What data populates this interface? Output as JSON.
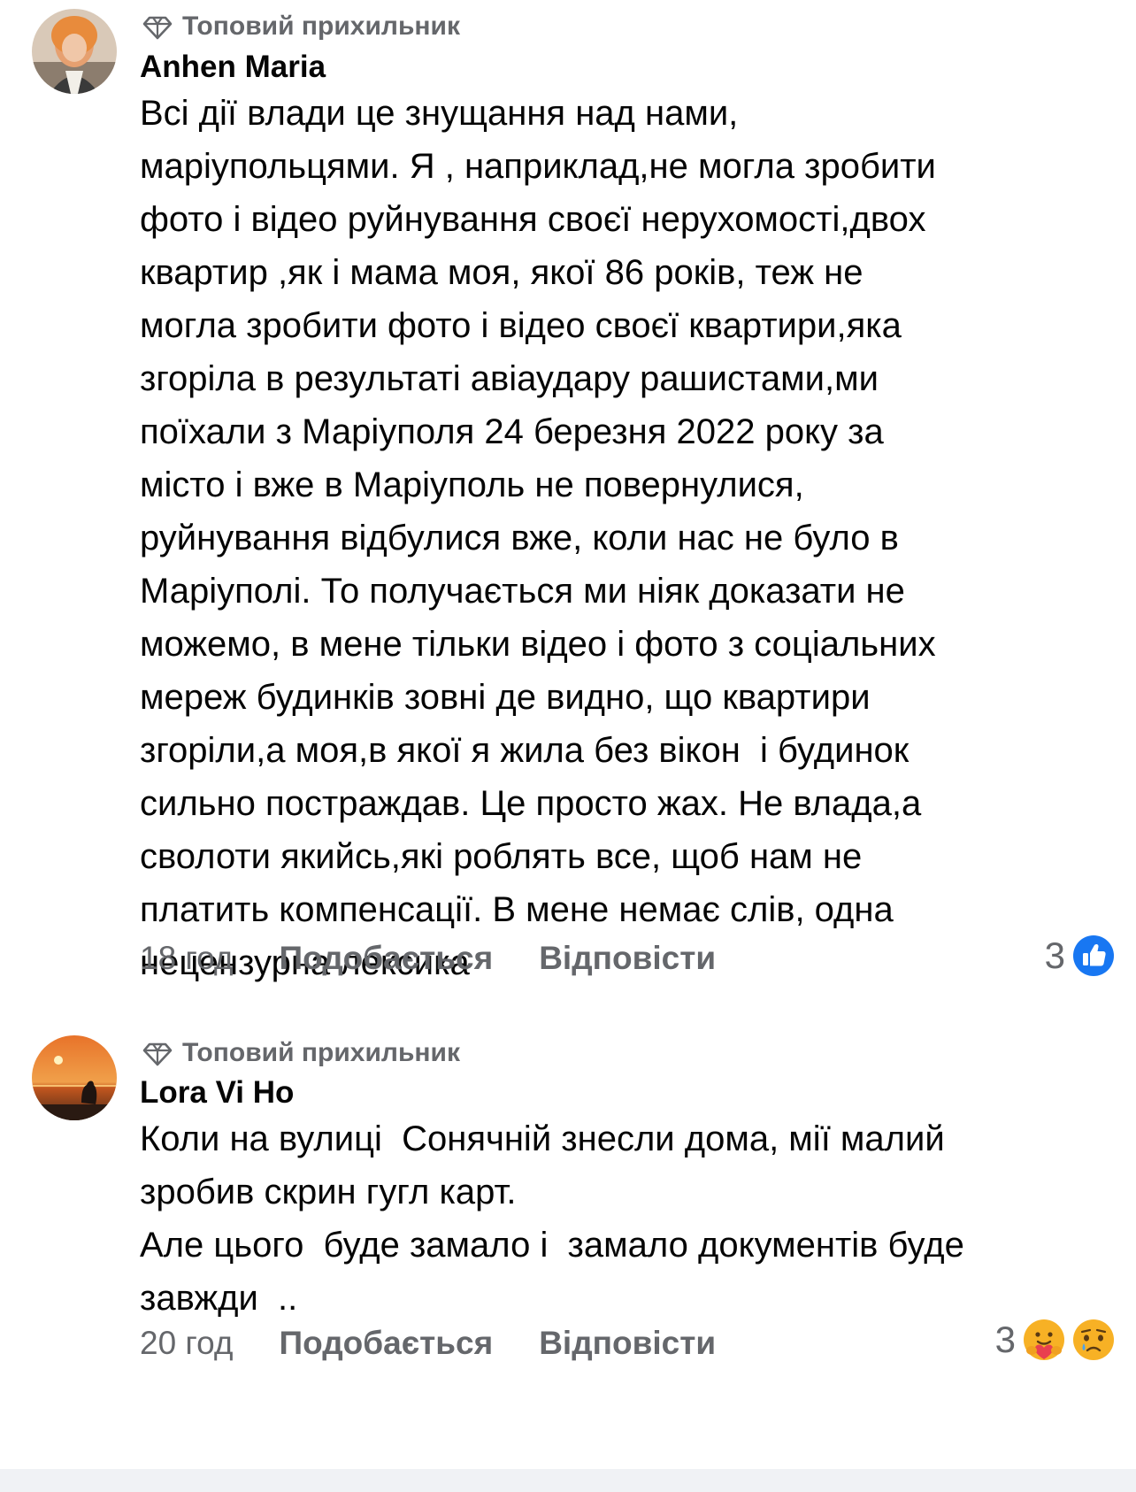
{
  "comments": [
    {
      "badge": "Топовий прихильник",
      "author": "Anhen Maria",
      "text": "Всі дії влади це знущання над нами,\nмаріупольцями. Я , наприклад,не могла зробити\nфото і відео руйнування своєї нерухомості,двох\nквартир ,як і мама моя, якої 86 років, теж не\nмогла зробити фото і відео своєї квартири,яка\nзгоріла в результаті авіаудару рашистами,ми\nпоїхали з Маріуполя 24 березня 2022 року за\nмісто і вже в Маріуполь не повернулися,\nруйнування відбулися вже, коли нас не було в\nМаріуполі. То получається ми ніяк доказати не\nможемо, в мене тільки відео і фото з соціальних\nмереж будинків зовні де видно, що квартири\nзгоріли,а моя,в якої я жила без вікон  і будинок\nсильно постраждав. Це просто жах. Не влада,а\nсволоти якийсь,які роблять все, щоб нам не\nплатить компенсації. В мене немає слів, одна\nнецензурна лексика",
      "time": "18 год",
      "like_label": "Подобається",
      "reply_label": "Відповісти",
      "reaction_count": "3",
      "reaction_icons": [
        "like-icon"
      ],
      "colors": {
        "like": "#1877f2"
      }
    },
    {
      "badge": "Топовий прихильник",
      "author": "Lora Vi Ho",
      "text": "Коли на вулиці  Сонячній знесли дома, мії малий\nзробив скрин гугл карт.\nАле цього  буде замало і  замало документів буде\nзавжди  ..",
      "time": "20 год",
      "like_label": "Подобається",
      "reply_label": "Відповісти",
      "reaction_count": "3",
      "reaction_icons": [
        "care-icon",
        "sad-icon"
      ],
      "colors": {
        "care": "#f7b125",
        "sad": "#f7b125"
      }
    }
  ],
  "colors": {
    "secondary_text": "#65676b",
    "primary_text": "#050505",
    "accent": "#1877f2"
  }
}
